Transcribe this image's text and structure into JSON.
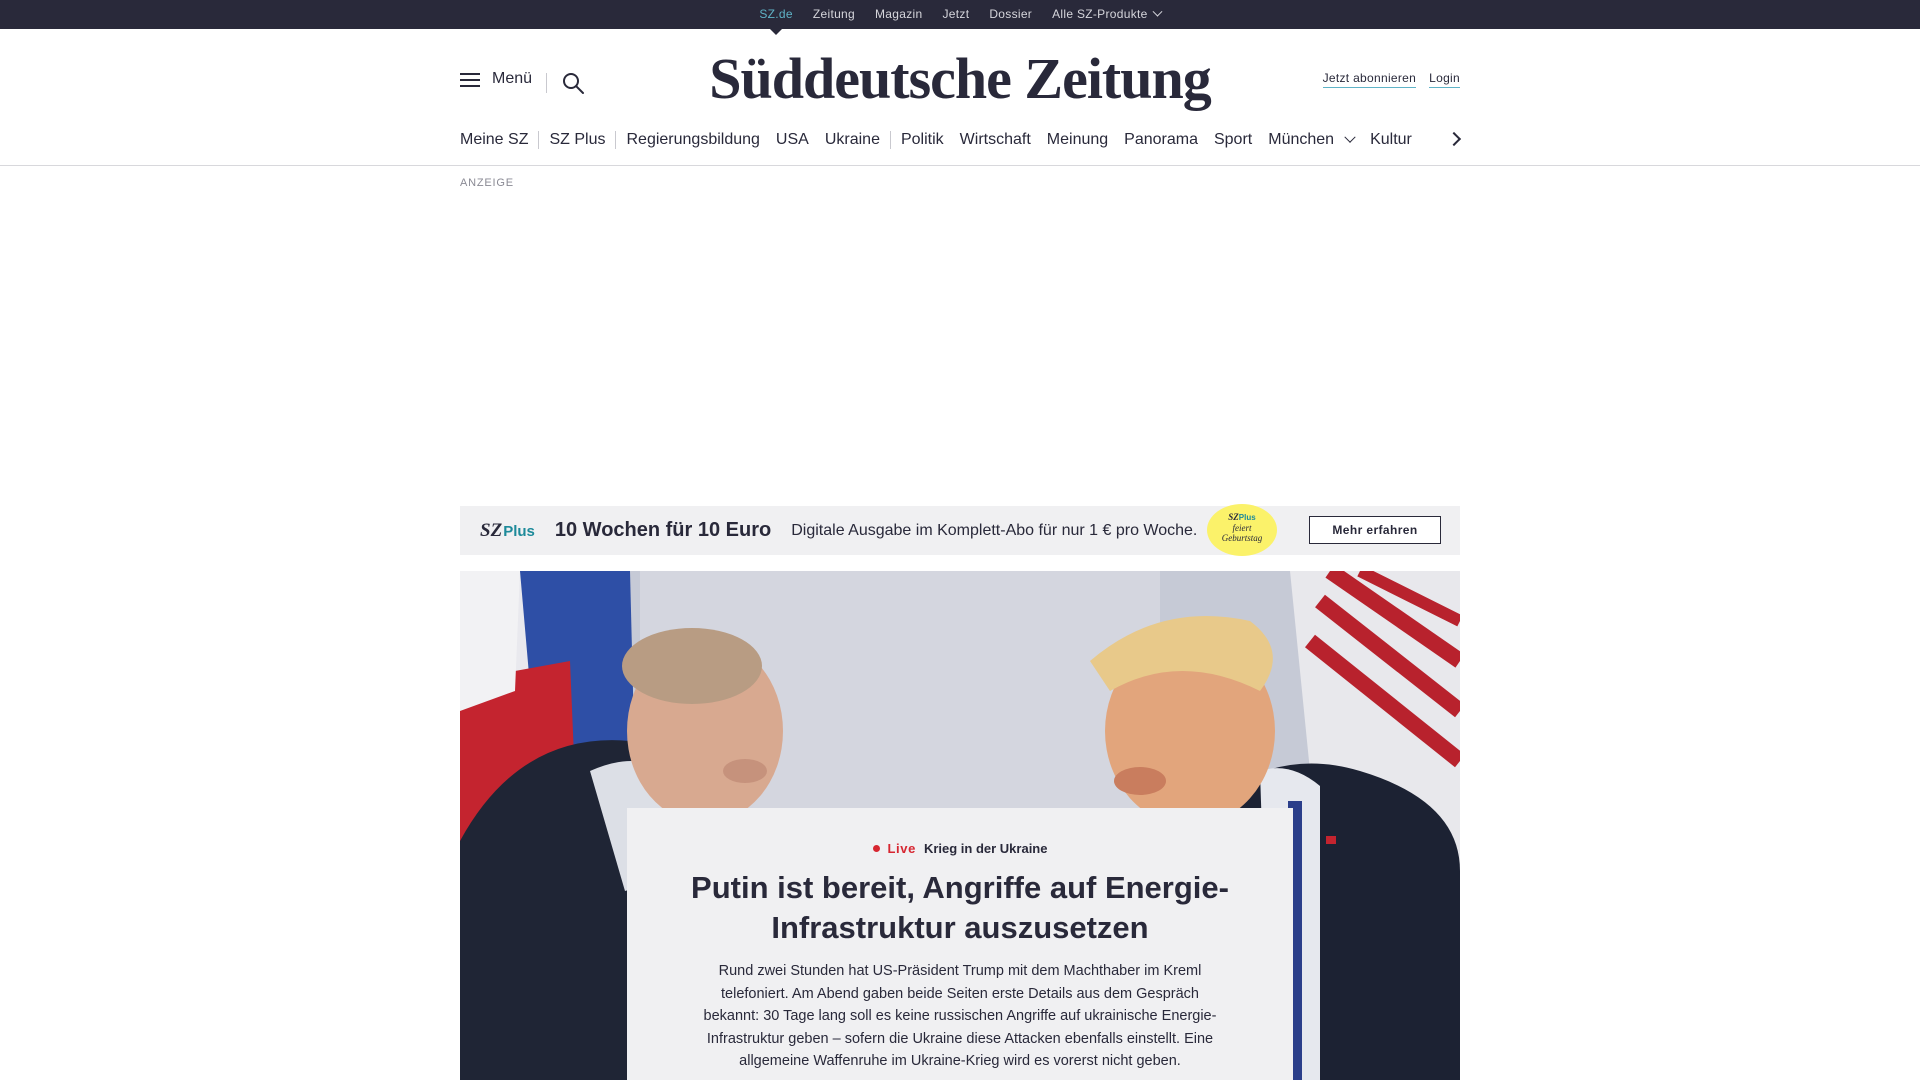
{
  "topbar": {
    "items": [
      "SZ.de",
      "Zeitung",
      "Magazin",
      "Jetzt",
      "Dossier",
      "Alle SZ-Produkte"
    ],
    "active": "SZ.de"
  },
  "header": {
    "menu_label": "Menü",
    "logo": "Süddeutsche Zeitung",
    "subscribe_label": "Jetzt abonnieren",
    "login_label": "Login"
  },
  "nav": {
    "items": [
      "Meine SZ",
      "SZ Plus",
      "Regierungsbildung",
      "USA",
      "Ukraine",
      "Politik",
      "Wirtschaft",
      "Meinung",
      "Panorama",
      "Sport",
      "München",
      "Kultur"
    ]
  },
  "ad": {
    "label": "ANZEIGE"
  },
  "promo": {
    "brand_sz": "SZ",
    "brand_plus": "Plus",
    "headline": "10 Wochen für 10 Euro",
    "subline": "Digitale Ausgabe im Komplett-Abo für nur 1 € pro Woche.",
    "badge_line1_sz": "SZ",
    "badge_line1_plus": "Plus",
    "badge_line2": "feiert",
    "badge_line3": "Geburtstag",
    "cta_label": "Mehr erfahren"
  },
  "hero": {
    "live_label": "Live",
    "topic": "Krieg in der Ukraine",
    "title": "Putin ist bereit, Angriffe auf Energie-Infrastruktur auszusetzen",
    "teaser": "Rund zwei Stunden hat US-Präsident Trump mit dem Machthaber im Kreml telefoniert. Am Abend gaben beide Seiten erste Details aus dem Gespräch bekannt: 30 Tage lang soll es keine russischen Angriffe auf ukrainische Energie-Infrastruktur geben – sofern die Ukraine diese Attacken ebenfalls einstellt. Eine allgemeine Waffenruhe im Ukraine-Krieg wird es vorerst nicht geben."
  },
  "colors": {
    "dark": "#29293a",
    "accent_teal": "#5fb3c7",
    "live_red": "#d72631",
    "promo_bg": "#f0f0f2",
    "badge_yellow": "#fbf26a"
  },
  "icons": [
    "hamburger-icon",
    "search-icon",
    "chevron-down-icon",
    "chevron-right-icon",
    "live-dot-icon"
  ]
}
